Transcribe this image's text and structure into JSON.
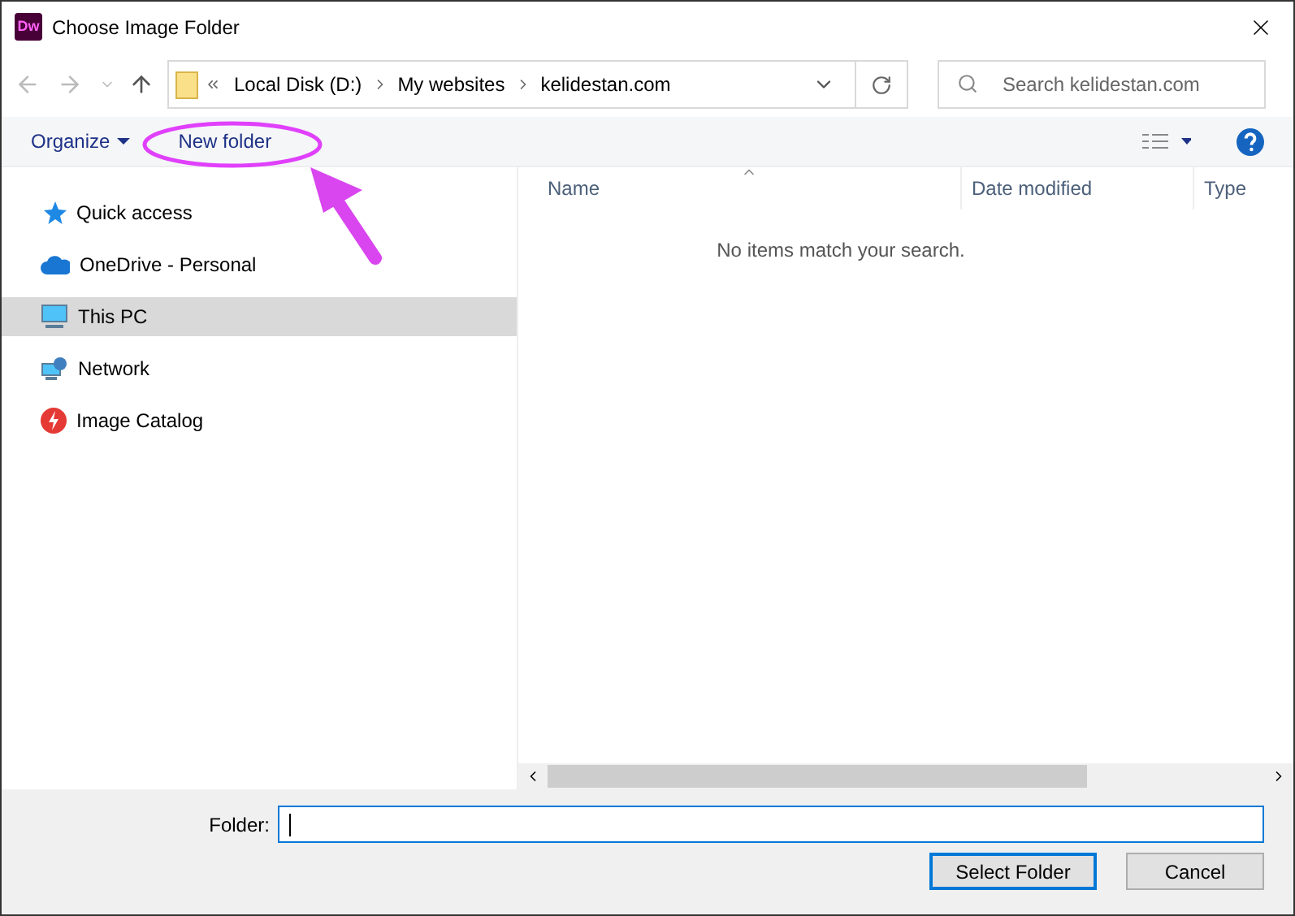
{
  "window": {
    "logo": "Dw",
    "title": "Choose Image Folder"
  },
  "address": {
    "segments": [
      "Local Disk (D:)",
      "My websites",
      "kelidestan.com"
    ]
  },
  "search": {
    "placeholder": "Search kelidestan.com"
  },
  "toolbar": {
    "organize": "Organize",
    "new_folder": "New folder"
  },
  "sidebar": {
    "items": [
      {
        "label": "Quick access",
        "kind": "star",
        "selected": false
      },
      {
        "label": "OneDrive - Personal",
        "kind": "cloud",
        "selected": false
      },
      {
        "label": "This PC",
        "kind": "pc",
        "selected": true
      },
      {
        "label": "Network",
        "kind": "network",
        "selected": false
      },
      {
        "label": "Image Catalog",
        "kind": "catalog",
        "selected": false
      }
    ]
  },
  "table": {
    "columns": [
      "Name",
      "Date modified",
      "Type"
    ],
    "empty_message": "No items match your search."
  },
  "footer": {
    "folder_label": "Folder:",
    "buttons": [
      "Select Folder",
      "Cancel"
    ]
  }
}
